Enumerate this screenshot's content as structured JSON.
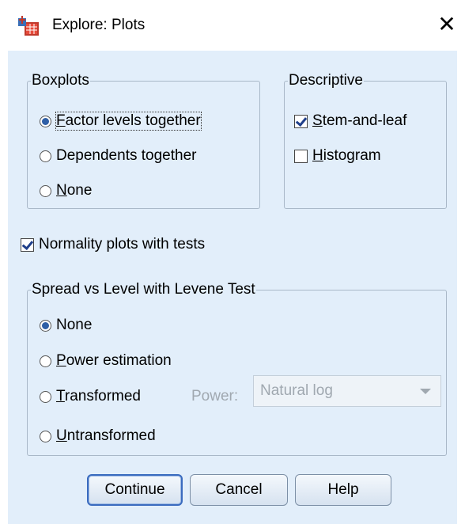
{
  "window": {
    "title": "Explore: Plots",
    "close_glyph": "✕",
    "icon": "spss-app-icon"
  },
  "boxplots": {
    "legend": "Boxplots",
    "options": [
      {
        "label": "Factor levels together",
        "selected": true
      },
      {
        "label": "Dependents together",
        "selected": false
      },
      {
        "label": "None",
        "selected": false
      }
    ]
  },
  "descriptive": {
    "legend": "Descriptive",
    "options": [
      {
        "label": "Stem-and-leaf",
        "checked": true
      },
      {
        "label": "Histogram",
        "checked": false
      }
    ]
  },
  "normality": {
    "label": "Normality plots with tests",
    "checked": true
  },
  "spread": {
    "legend": "Spread vs Level with Levene Test",
    "options": [
      {
        "label": "None",
        "selected": true
      },
      {
        "label": "Power estimation",
        "selected": false
      },
      {
        "label": "Transformed",
        "selected": false
      },
      {
        "label": "Untransformed",
        "selected": false
      }
    ],
    "power_label": "Power:",
    "power_value": "Natural log"
  },
  "buttons": {
    "continue": "Continue",
    "cancel": "Cancel",
    "help": "Help"
  },
  "colors": {
    "client_bg": "#e2eefa",
    "accent": "#2f5fa6",
    "border": "#a9b8c8"
  }
}
